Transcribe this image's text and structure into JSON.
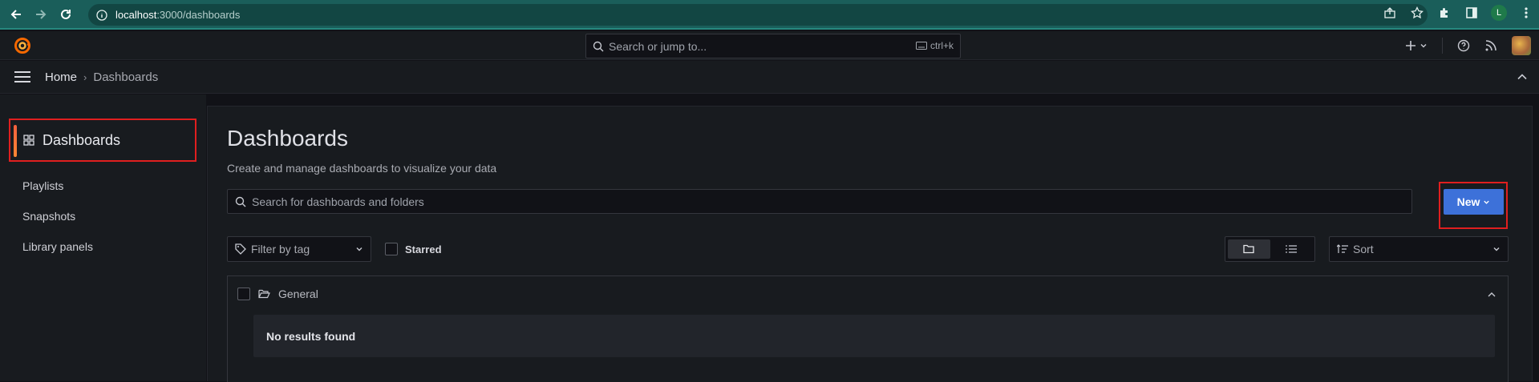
{
  "browser": {
    "url_host": "localhost",
    "url_path": ":3000/dashboards",
    "profile_initial": "L"
  },
  "topbar": {
    "search_placeholder": "Search or jump to...",
    "shortcut": "ctrl+k"
  },
  "breadcrumb": {
    "home": "Home",
    "separator": "›",
    "current": "Dashboards"
  },
  "sidebar": {
    "header": "Dashboards",
    "items": [
      {
        "label": "Playlists"
      },
      {
        "label": "Snapshots"
      },
      {
        "label": "Library panels"
      }
    ]
  },
  "main": {
    "title": "Dashboards",
    "subtitle": "Create and manage dashboards to visualize your data",
    "search_placeholder": "Search for dashboards and folders",
    "new_button": "New",
    "filter_tag_placeholder": "Filter by tag",
    "starred_label": "Starred",
    "sort_placeholder": "Sort",
    "folder": {
      "name": "General",
      "empty_message": "No results found"
    }
  },
  "colors": {
    "accent_blue": "#3d71d9",
    "highlight_red": "#e01f1f",
    "active_orange": "#f55f3e",
    "browser_teal": "#1a5e5a"
  }
}
